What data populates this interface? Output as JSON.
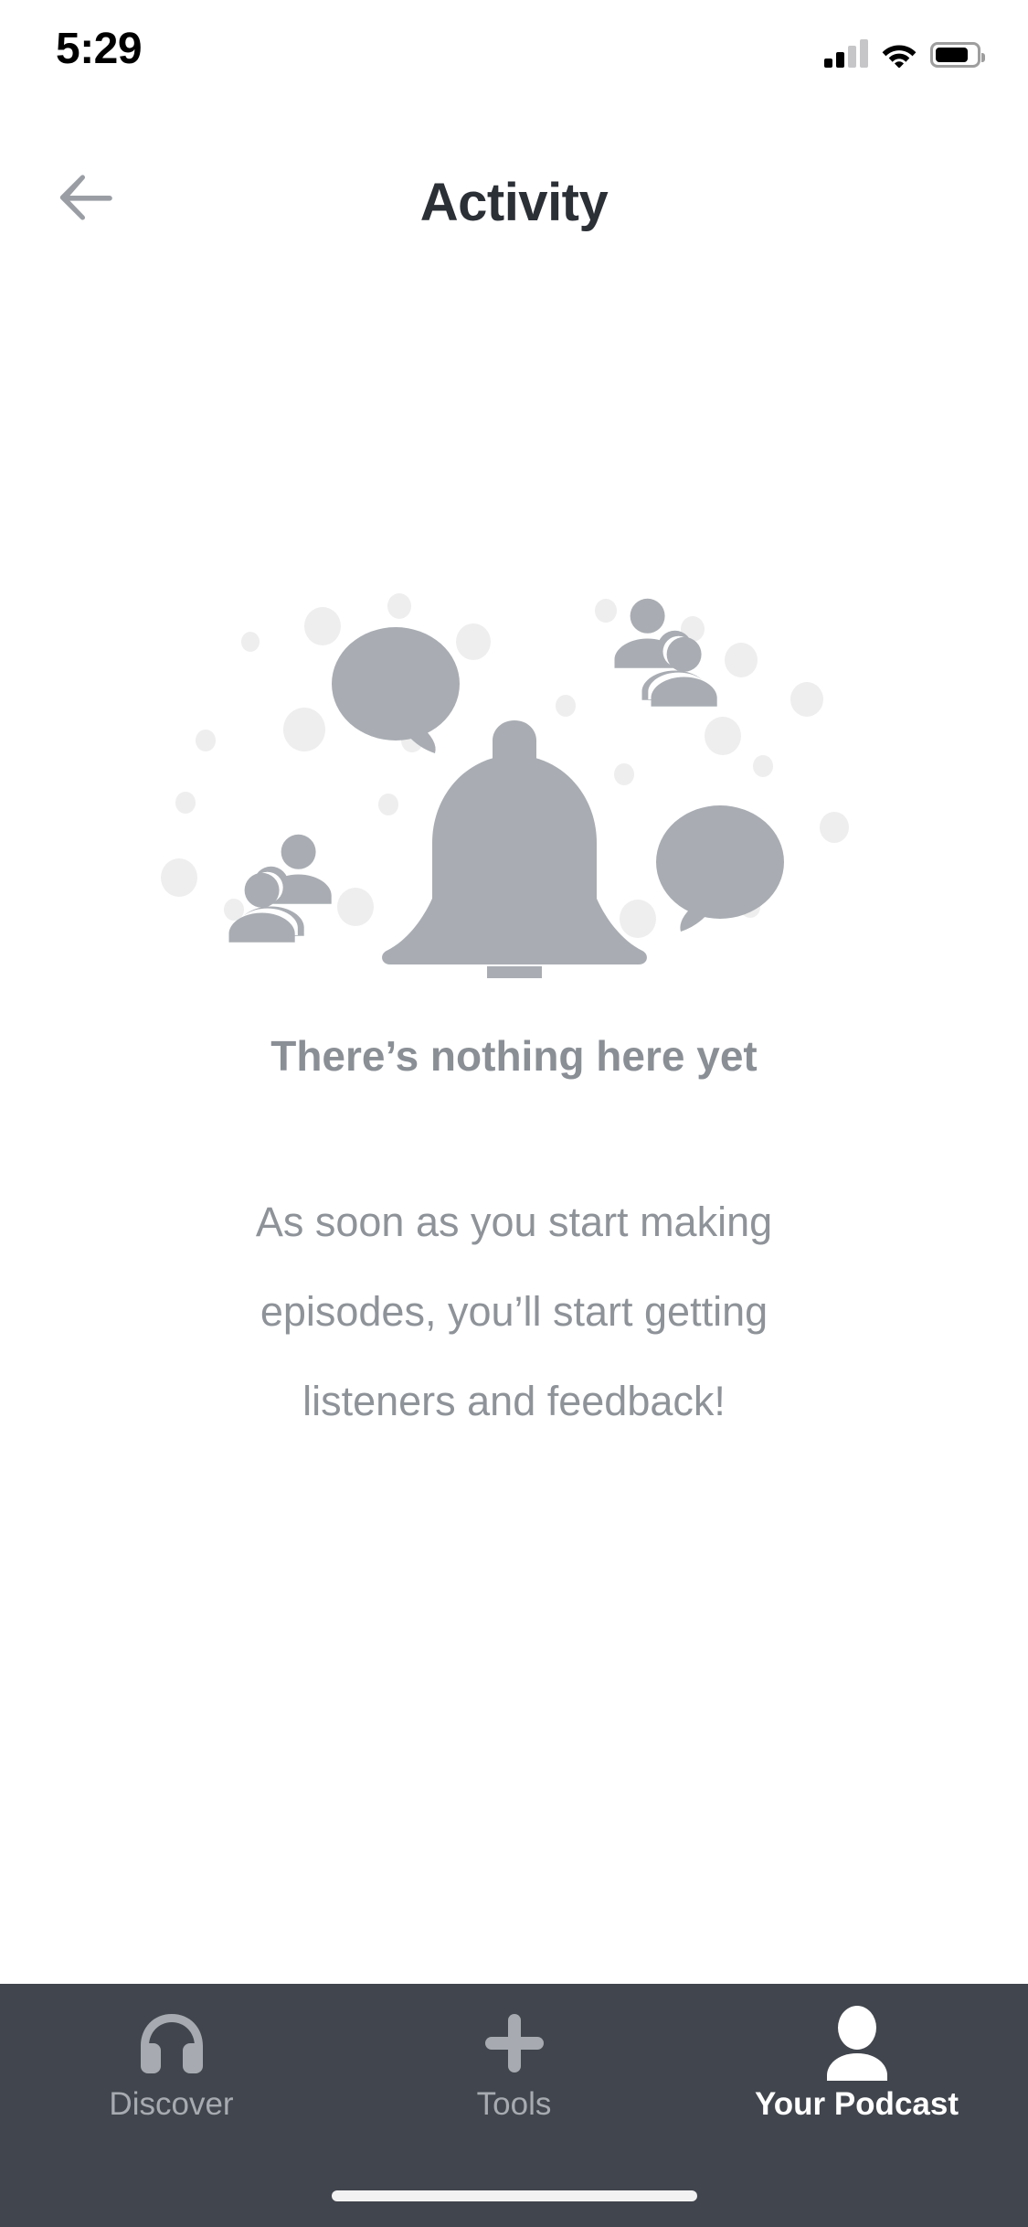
{
  "status_bar": {
    "time": "5:29",
    "cellular_bars_filled": 2,
    "cellular_bars_total": 4,
    "wifi": "wifi-full",
    "battery_percent": 72
  },
  "header": {
    "title": "Activity",
    "back_label": "Back",
    "back_icon": "arrow-left-icon",
    "title_color": "#2b2f36",
    "back_icon_color": "#9a9ea4"
  },
  "empty_state": {
    "illustration_name": "bell-notification-illustration",
    "illustration_elements": [
      "bell-icon",
      "speech-bubble-icon",
      "people-group-icon",
      "dot"
    ],
    "title": "There’s nothing here yet",
    "body": "As soon as you start making episodes, you’ll start getting listeners and feedback!",
    "body_lines": [
      "As soon as you start making",
      "episodes, you’ll start getting",
      "listeners and feedback!"
    ],
    "title_color": "#8a8f96",
    "body_color": "#8e9399",
    "illustration_primary_color": "#a9adb3",
    "illustration_dot_color": "#eeeeee"
  },
  "tab_bar": {
    "background_color": "#41454d",
    "inactive_color": "#a7abb1",
    "active_color": "#ffffff",
    "items": [
      {
        "label": "Discover",
        "icon": "headphones-icon",
        "active": false
      },
      {
        "label": "Tools",
        "icon": "plus-icon",
        "active": false
      },
      {
        "label": "Your Podcast",
        "icon": "person-icon",
        "active": true
      }
    ]
  },
  "home_indicator": {
    "name": "home-indicator"
  }
}
